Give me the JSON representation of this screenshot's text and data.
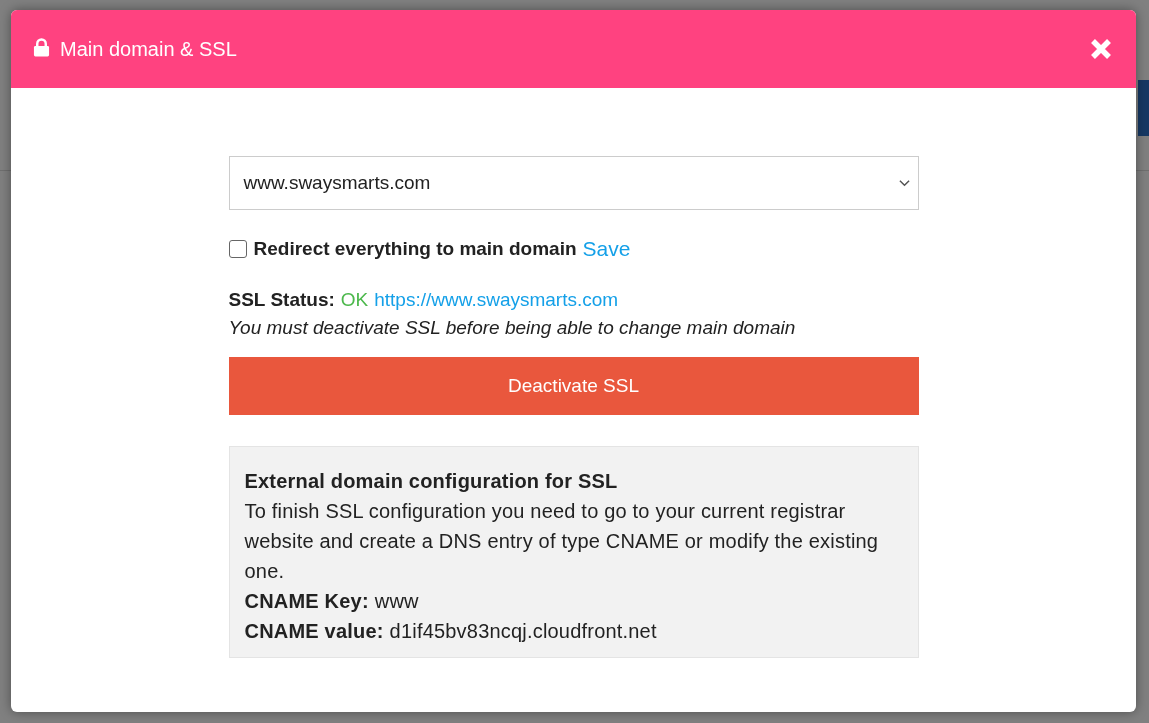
{
  "modal": {
    "title": "Main domain & SSL",
    "domain_select": {
      "value": "www.swaysmarts.com"
    },
    "redirect": {
      "label": "Redirect everything to main domain",
      "checked": false,
      "save": "Save"
    },
    "ssl": {
      "label": "SSL Status:",
      "status": "OK",
      "url": "https://www.swaysmarts.com",
      "note": "You must deactivate SSL before being able to change main domain"
    },
    "deactivate_button": "Deactivate SSL",
    "info": {
      "title": "External domain configuration for SSL",
      "text": "To finish SSL configuration you need to go to your current registrar website and create a DNS entry of type CNAME or modify the existing one.",
      "lines": [
        {
          "label": "CNAME Key:",
          "value": "www"
        },
        {
          "label": "CNAME value:",
          "value": "d1if45bv83ncqj.cloudfront.net"
        }
      ]
    }
  }
}
